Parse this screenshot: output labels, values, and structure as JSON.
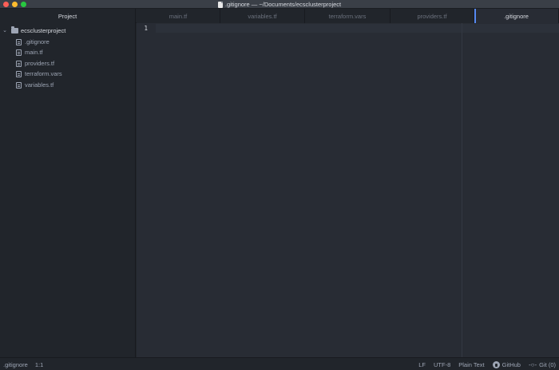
{
  "window": {
    "title": ".gitignore — ~/Documents/ecsclusterproject"
  },
  "sidebar": {
    "header": "Project",
    "root_folder": "ecsclusterproject",
    "files": [
      {
        "label": ".gitignore"
      },
      {
        "label": "main.tf"
      },
      {
        "label": "providers.tf"
      },
      {
        "label": "terraform.vars"
      },
      {
        "label": "variables.tf"
      }
    ]
  },
  "tabs": [
    {
      "label": "main.tf",
      "active": false
    },
    {
      "label": "variables.tf",
      "active": false
    },
    {
      "label": "terraform.vars",
      "active": false
    },
    {
      "label": "providers.tf",
      "active": false
    },
    {
      "label": ".gitignore",
      "active": true
    }
  ],
  "editor": {
    "line_numbers": [
      "1"
    ]
  },
  "statusbar": {
    "file": ".gitignore",
    "cursor": "1:1",
    "line_ending": "LF",
    "encoding": "UTF-8",
    "grammar": "Plain Text",
    "github": "GitHub",
    "git": "Git (0)"
  },
  "colors": {
    "accent": "#568af2",
    "background": "#21252b",
    "editor_background": "#282c34"
  },
  "icons": {
    "file": "file-icon",
    "folder": "folder-icon",
    "expand": "chevron-down-icon",
    "github": "github-icon",
    "git": "git-commit-icon"
  }
}
